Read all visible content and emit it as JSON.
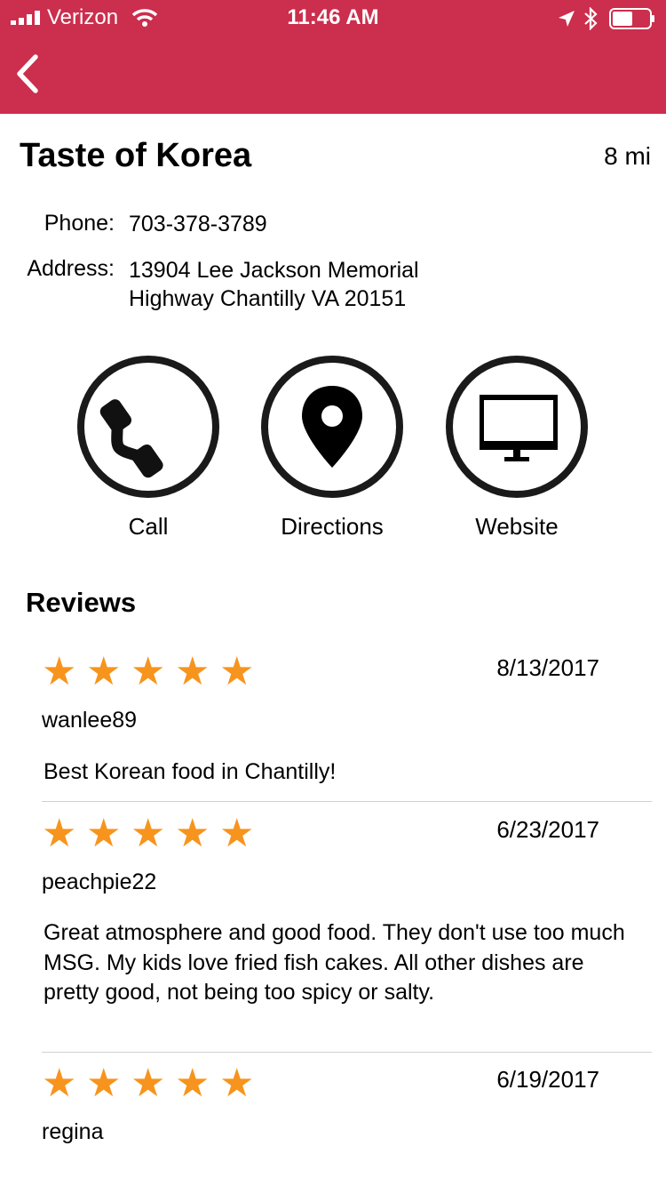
{
  "status_bar": {
    "carrier": "Verizon",
    "time": "11:46 AM"
  },
  "nav": {
    "back_icon": "chevron-left-icon",
    "background_color": "#cc2e4d"
  },
  "restaurant": {
    "name": "Taste of Korea",
    "distance": "8 mi",
    "phone_label": "Phone:",
    "phone": "703-378-3789",
    "address_label": "Address:",
    "address_line1": "13904 Lee Jackson Memorial",
    "address_line2": "Highway  Chantilly VA 20151"
  },
  "actions": {
    "call": {
      "label": "Call",
      "icon": "phone-icon"
    },
    "directions": {
      "label": "Directions",
      "icon": "map-pin-icon"
    },
    "website": {
      "label": "Website",
      "icon": "monitor-icon"
    }
  },
  "reviews": {
    "heading": "Reviews",
    "star_color": "#f7941d",
    "items": [
      {
        "rating": 5,
        "date": "8/13/2017",
        "user": "wanlee89",
        "text": "Best Korean food in Chantilly!"
      },
      {
        "rating": 5,
        "date": "6/23/2017",
        "user": "peachpie22",
        "text": "Great atmosphere and good food.  They don't use too much MSG.  My kids love fried fish cakes.  All other dishes are pretty good, not being too spicy or salty."
      },
      {
        "rating": 5,
        "date": "6/19/2017",
        "user": "regina",
        "text": ""
      }
    ]
  }
}
